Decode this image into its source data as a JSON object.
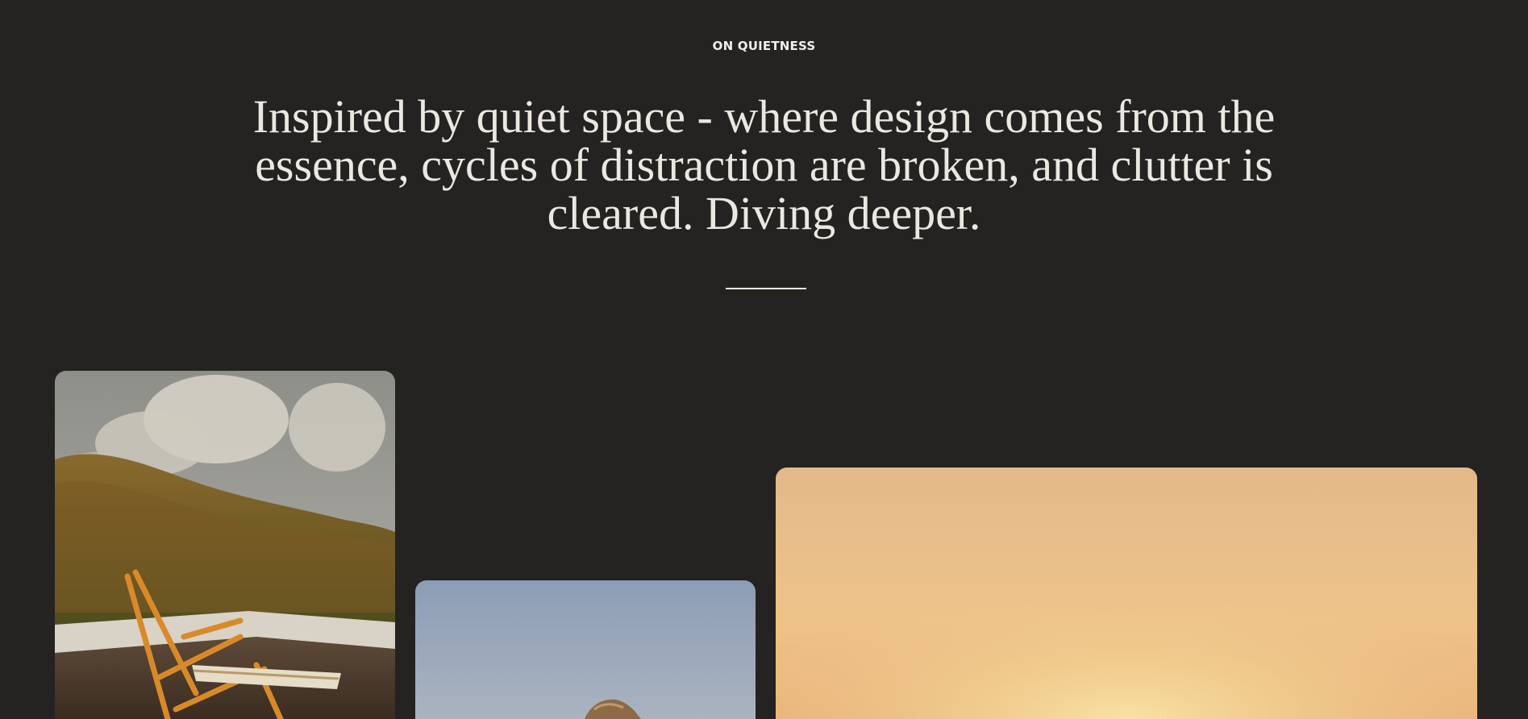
{
  "section": {
    "eyebrow": "ON QUIETNESS",
    "headline": "Inspired by quiet space - where design comes from the essence, cycles of distraction are broken, and clutter is cleared. Diving deeper."
  },
  "gallery": {
    "photos": [
      {
        "subject": "wooden deck chair on terrace with grassy hill and clouds"
      },
      {
        "subject": "rocky outcrop against blue sky"
      },
      {
        "subject": "warm golden hazy sunset sky"
      }
    ]
  },
  "colors": {
    "background": "#242322",
    "text": "#ece8e1",
    "accent_warm": "#e8b77a"
  }
}
